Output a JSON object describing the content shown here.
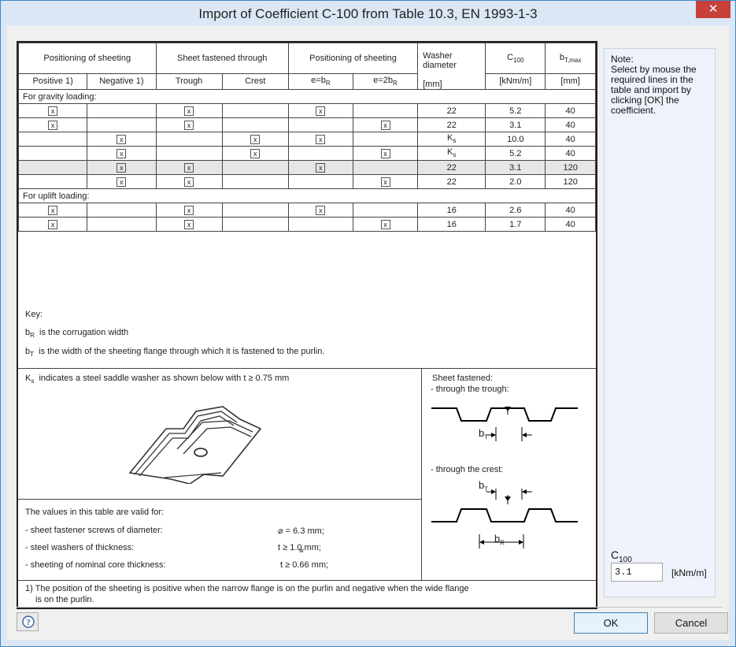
{
  "window": {
    "title": "Import of Coefficient C-100 from Table 10.3, EN 1993-1-3",
    "close_glyph": "✕"
  },
  "table": {
    "header_groups": [
      "Positioning of sheeting",
      "Sheet fastened through",
      "Positioning of sheeting",
      "Washer diameter",
      "C",
      "b"
    ],
    "c_sub": "100",
    "bt_sub": "T,max",
    "subheaders": [
      "Positive 1)",
      "Negative 1)",
      "Trough",
      "Crest",
      "e=b",
      "e=2b",
      "[mm]",
      "[kNm/m]",
      "[mm]"
    ],
    "e_sub": "R",
    "gravity_label": "For gravity loading:",
    "uplift_label": "For uplift loading:",
    "check_glyph": "x",
    "gravity_rows": [
      {
        "marks": [
          1,
          0,
          1,
          0,
          1,
          0
        ],
        "washer": "22",
        "c100": "5.2",
        "bt": "40"
      },
      {
        "marks": [
          1,
          0,
          1,
          0,
          0,
          1
        ],
        "washer": "22",
        "c100": "3.1",
        "bt": "40"
      },
      {
        "marks": [
          0,
          1,
          0,
          1,
          1,
          0
        ],
        "washer": "K",
        "c100": "10.0",
        "bt": "40"
      },
      {
        "marks": [
          0,
          1,
          0,
          1,
          0,
          1
        ],
        "washer": "K",
        "c100": "5.2",
        "bt": "40"
      },
      {
        "marks": [
          0,
          1,
          1,
          0,
          1,
          0
        ],
        "washer": "22",
        "c100": "3.1",
        "bt": "120",
        "selected": true
      },
      {
        "marks": [
          0,
          1,
          1,
          0,
          0,
          1
        ],
        "washer": "22",
        "c100": "2.0",
        "bt": "120"
      }
    ],
    "uplift_rows": [
      {
        "marks": [
          1,
          0,
          1,
          0,
          1,
          0
        ],
        "washer": "16",
        "c100": "2.6",
        "bt": "40"
      },
      {
        "marks": [
          1,
          0,
          1,
          0,
          0,
          1
        ],
        "washer": "16",
        "c100": "1.7",
        "bt": "40"
      }
    ],
    "ks_sub": "s"
  },
  "key": {
    "title": "Key:",
    "br_sym": "b",
    "br_sub": "R",
    "br_text": "is the corrugation width",
    "bt_sym": "b",
    "bt_sub": "T",
    "bt_text": "is the width of the sheeting flange through which it is fastened to the purlin."
  },
  "ks_note": {
    "sym": "K",
    "sub": "s",
    "text": "indicates a steel saddle washer as shown below with t ≥ 0.75 mm"
  },
  "sheet_fastened": {
    "title": "Sheet fastened:",
    "trough": "- through the trough:",
    "crest": "- through the crest:",
    "bt": "b",
    "bt_sub": "T",
    "br": "b",
    "br_sub": "R"
  },
  "valid": {
    "title": "The values in this table are valid for:",
    "rows": [
      {
        "label": "-   sheet fastener screws of diameter:",
        "value": "⌀ = 6.3 mm;"
      },
      {
        "label": "-   steel washers of thickness:",
        "value": "t  ≥ 1.0 mm;",
        "value_sub": "w"
      },
      {
        "label": "-   sheeting of nominal core thickness:",
        "value": "t ≥ 0.66 mm;"
      }
    ]
  },
  "footnote": {
    "line1": "1) The position of the sheeting is positive when the narrow flange is on the purlin and negative when the wide flange",
    "line2": "is on the purlin."
  },
  "note": {
    "text": "Note:\nSelect by mouse the required lines in the table and import by clicking [OK] the coefficient."
  },
  "result": {
    "label": "C",
    "label_sub": "100",
    "value": "3.1",
    "unit": "[kNm/m]"
  },
  "buttons": {
    "ok": "OK",
    "cancel": "Cancel",
    "help_icon": "help-icon"
  }
}
